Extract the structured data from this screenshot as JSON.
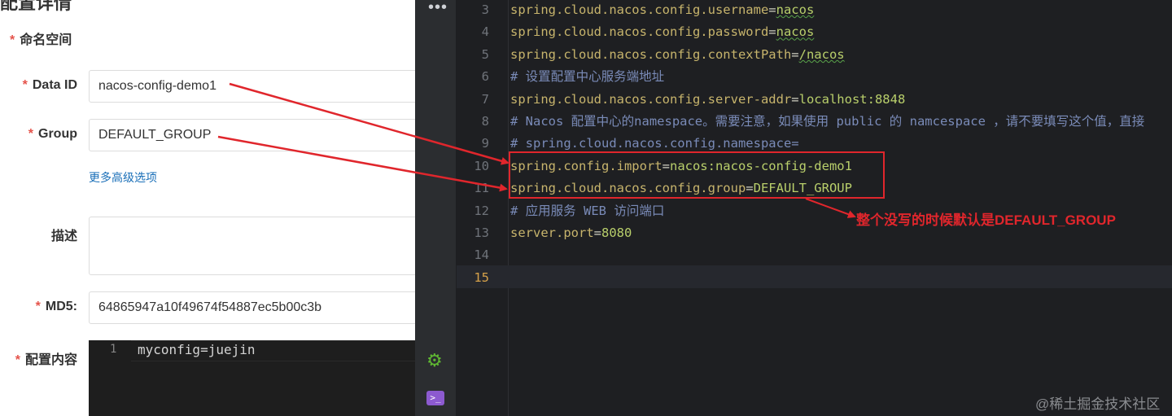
{
  "form": {
    "top_cut_title": "配置详情",
    "namespace_label": "命名空间",
    "dataid_label": "Data ID",
    "dataid_value": "nacos-config-demo1",
    "group_label": "Group",
    "group_value": "DEFAULT_GROUP",
    "advanced_link": "更多高级选项",
    "desc_label": "描述",
    "md5_label": "MD5:",
    "md5_value": "64865947a10f49674f54887ec5b00c3b",
    "content_label": "配置内容",
    "required_mark": "*",
    "editor": {
      "line_no": "1",
      "line_text": "myconfig=juejin"
    }
  },
  "ide": {
    "more_icon": "more-dots-icon",
    "settings_icon": "gear-icon",
    "terminal_icon": "terminal-icon",
    "lines": [
      {
        "no": "3",
        "key": "spring.cloud.nacos.config.username",
        "eq": "=",
        "val": "nacos"
      },
      {
        "no": "4",
        "key": "spring.cloud.nacos.config.password",
        "eq": "=",
        "val": "nacos"
      },
      {
        "no": "5",
        "key": "spring.cloud.nacos.config.contextPath",
        "eq": "=",
        "val": "/nacos"
      },
      {
        "no": "6",
        "comment": "# 设置配置中心服务端地址"
      },
      {
        "no": "7",
        "key": "spring.cloud.nacos.config.server-addr",
        "eq": "=",
        "val": "localhost:8848"
      },
      {
        "no": "8",
        "comment": "# Nacos 配置中心的namespace。需要注意，如果使用 public 的 namcespace ，请不要填写这个值，直接"
      },
      {
        "no": "9",
        "comment": "# spring.cloud.nacos.config.namespace="
      },
      {
        "no": "10",
        "key": "spring.config.import",
        "eq": "=",
        "val": "nacos:nacos-config-demo1"
      },
      {
        "no": "11",
        "key": "spring.cloud.nacos.config.group",
        "eq": "=",
        "val": "DEFAULT_GROUP"
      },
      {
        "no": "12",
        "comment": "# 应用服务 WEB 访问端口"
      },
      {
        "no": "13",
        "key": "server.port",
        "eq": "=",
        "val": "8080"
      },
      {
        "no": "14"
      },
      {
        "no": "15"
      }
    ],
    "annotation": "整个没写的时候默认是DEFAULT_GROUP",
    "watermark": "@稀土掘金技术社区"
  }
}
